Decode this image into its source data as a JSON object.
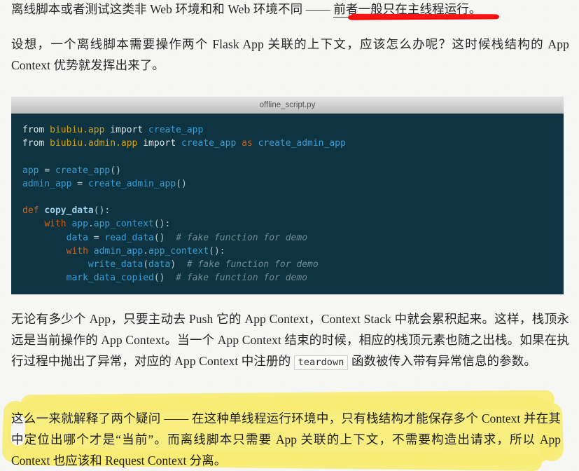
{
  "document": {
    "background_color": "#f6f6f4",
    "text_color": "#262626"
  },
  "paragraphs": {
    "p1": {
      "lead": "离线脚本或者测试这类非 Web 环境和和 Web 环境不同 —— ",
      "underlined": "前者一般只在主线程运行。",
      "underline_color": "#fa1414"
    },
    "p2": "设想，一个离线脚本需要操作两个 Flask App 关联的上下文，应该怎么办呢？这时候栈结构的 App Context 优势就发挥出来了。",
    "p3": {
      "part1": "无论有多少个 App，只要主动去 Push 它的 App Context，Context Stack 中就会累积起来。这样，栈顶永远是当前操作的 App Context。当一个 App Context 结束的时候，相应的栈顶元素也随之出栈。如果在执行过程中抛出了异常，对应的 App Context 中注册的 ",
      "inline_code": "teardown",
      "part2": " 函数被传入带有异常信息的参数。"
    },
    "p4": {
      "text": "这么一来就解释了两个疑问 —— 在这种单线程运行环境中，只有栈结构才能保存多个 Context 并在其中定位出哪个才是“当前”。而离线脚本只需要 App 关联的上下文，不需要构造出请求，所以 App Context 也应该和 Request Context 分离。",
      "highlight_color": "#f7eb74"
    }
  },
  "code_block": {
    "caption": "offline_script.py",
    "background_color": "#0d3440",
    "language": "python",
    "lines": [
      "from biubiu.app import create_app",
      "from biubiu.admin.app import create_app as create_admin_app",
      "",
      "app = create_app()",
      "admin_app = create_admin_app()",
      "",
      "def copy_data():",
      "    with app.app_context():",
      "        data = read_data()  # fake function for demo",
      "        with admin_app.app_context():",
      "            write_data(data)  # fake function for demo",
      "        mark_data_copied()  # fake function for demo"
    ],
    "tokens": {
      "keyword_color": "#d2601a",
      "import_color": "#dfe5e7",
      "module_color": "#d3a21a",
      "name_color": "#3b9dd4",
      "comment_color": "#6f8b93",
      "default_color": "#c7d4d8"
    }
  }
}
